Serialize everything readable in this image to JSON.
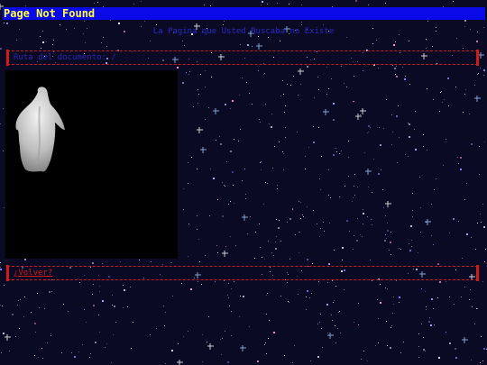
{
  "window": {
    "title": "Page Not Found"
  },
  "message": {
    "text": "La Pagina que Usted Buscaba no Existe"
  },
  "path_bar": {
    "text": "Ruta del documento: /"
  },
  "back_link": {
    "label": "¿Volver?"
  },
  "illustration": {
    "icon": "ghost-icon"
  },
  "colors": {
    "background": "#0b0a24",
    "title_bar": "#0a0ae8",
    "title_text": "#ffff40",
    "frame": "#d21a1a",
    "muted_text": "#2a2ab8"
  }
}
